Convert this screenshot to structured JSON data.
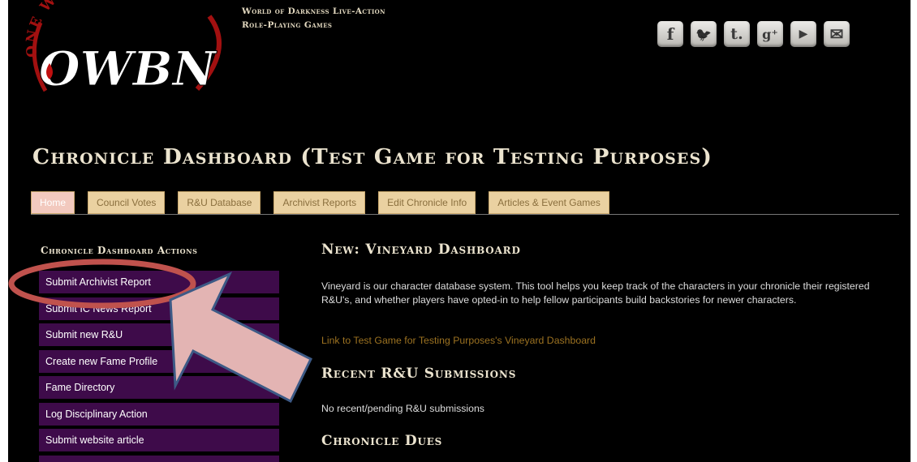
{
  "header": {
    "logo_text": "OWBN",
    "logo_arc_text": "ONE WORLD BY NIGHT",
    "tagline_line1": "World of Darkness Live-Action",
    "tagline_line2": "Role-Playing Games"
  },
  "social": [
    {
      "icon": "facebook-icon",
      "glyph": "f"
    },
    {
      "icon": "twitter-icon",
      "glyph": "🐦"
    },
    {
      "icon": "tumblr-icon",
      "glyph": "t."
    },
    {
      "icon": "google-plus-icon",
      "glyph": "g⁺"
    },
    {
      "icon": "youtube-icon",
      "glyph": "▶"
    },
    {
      "icon": "email-icon",
      "glyph": "✉"
    }
  ],
  "page_title": "Chronicle Dashboard (Test Game for Testing Purposes)",
  "tabs": [
    {
      "label": "Home",
      "active": true
    },
    {
      "label": "Council Votes",
      "active": false
    },
    {
      "label": "R&U Database",
      "active": false
    },
    {
      "label": "Archivist Reports",
      "active": false
    },
    {
      "label": "Edit Chronicle Info",
      "active": false
    },
    {
      "label": "Articles & Event Games",
      "active": false
    }
  ],
  "sidebar": {
    "heading": "Chronicle Dashboard Actions",
    "items": [
      "Submit Archivist Report",
      "Submit IC News Report",
      "Submit new R&U",
      "Create new Fame Profile",
      "Fame Directory",
      "Log Disciplinary Action",
      "Submit website article"
    ]
  },
  "main": {
    "vineyard_heading": "New: Vineyard Dashboard",
    "vineyard_text": "Vineyard is our character database system. This tool helps you keep track of the characters in your chronicle their registered R&U's, and whether players have opted-in to help fellow participants build backstories for newer characters.",
    "vineyard_link": "Link to Test Game for Testing Purposes's Vineyard Dashboard",
    "ru_heading": "Recent R&U Submissions",
    "ru_empty": "No recent/pending R&U submissions",
    "dues_heading": "Chronicle Dues"
  },
  "colors": {
    "background": "#000000",
    "tab_bg": "#ead1a1",
    "tab_active_bg": "#f2c9be",
    "sidebar_btn_bg": "#3e0b4a",
    "link": "#9c7221",
    "annotation_ellipse": "#c0524d",
    "annotation_arrow_fill": "#e3b4b3",
    "annotation_arrow_stroke": "#3d5a86"
  }
}
